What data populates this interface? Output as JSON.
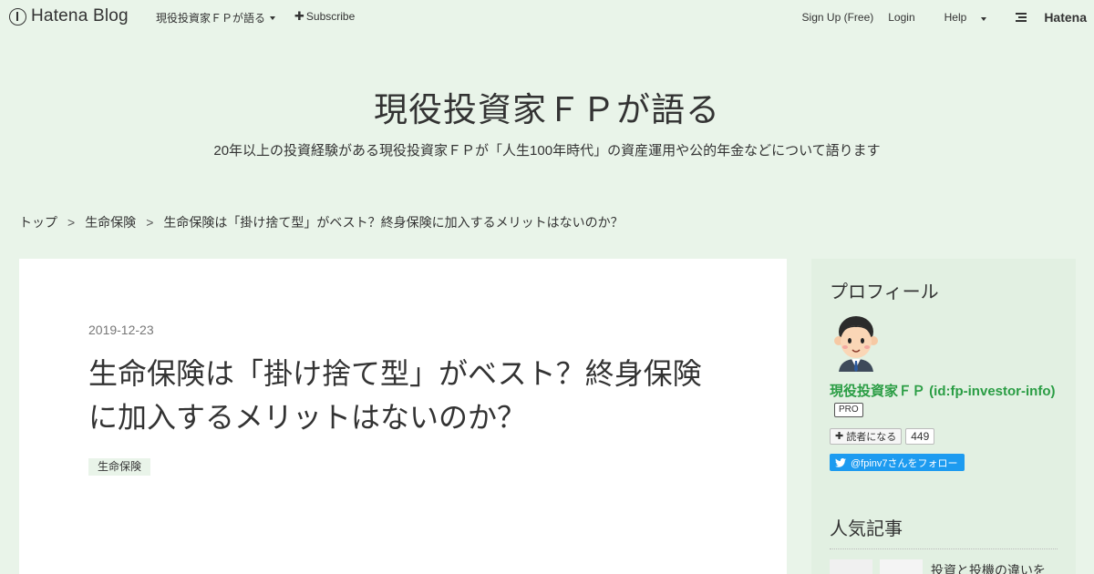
{
  "header": {
    "logo_text": "Hatena Blog",
    "blog_menu_label": "現役投資家ＦＰが語る",
    "subscribe_label": "Subscribe",
    "signup_label": "Sign Up (Free)",
    "login_label": "Login",
    "help_label": "Help",
    "hatena_label": "Hatena"
  },
  "blog": {
    "title": "現役投資家ＦＰが語る",
    "description": "20年以上の投資経験がある現役投資家ＦＰが「人生100年時代」の資産運用や公的年金などについて語ります"
  },
  "breadcrumb": {
    "items": [
      "トップ",
      "生命保険",
      "生命保険は「掛け捨て型」がベスト？終身保険に加入するメリットはないのか？"
    ],
    "separator": ">"
  },
  "article": {
    "date": "2019-12-23",
    "title": "生命保険は「掛け捨て型」がベスト？終身保険に加入するメリットはないのか？",
    "category": "生命保険"
  },
  "sidebar": {
    "profile_heading": "プロフィール",
    "profile_name": "現役投資家ＦＰ (id:fp-investor-info)",
    "pro_badge": "PRO",
    "reader_button_label": "読者になる",
    "reader_count": "449",
    "twitter_button_label": "@fpinv7さんをフォロー",
    "popular_heading": "人気記事",
    "popular_item_partial": "投資と投機の違いを"
  },
  "colors": {
    "page_background": "#e9f4e9",
    "card_background": "#ffffff",
    "sidebar_background": "#e2f0e2",
    "profile_name": "#2a9d44",
    "twitter_blue": "#1d9bf0"
  },
  "icons": [
    "hatena-blog-logo-icon",
    "chevron-down-icon",
    "plus-icon",
    "hatena-logo-icon",
    "avatar-illustration",
    "twitter-bird-icon"
  ]
}
